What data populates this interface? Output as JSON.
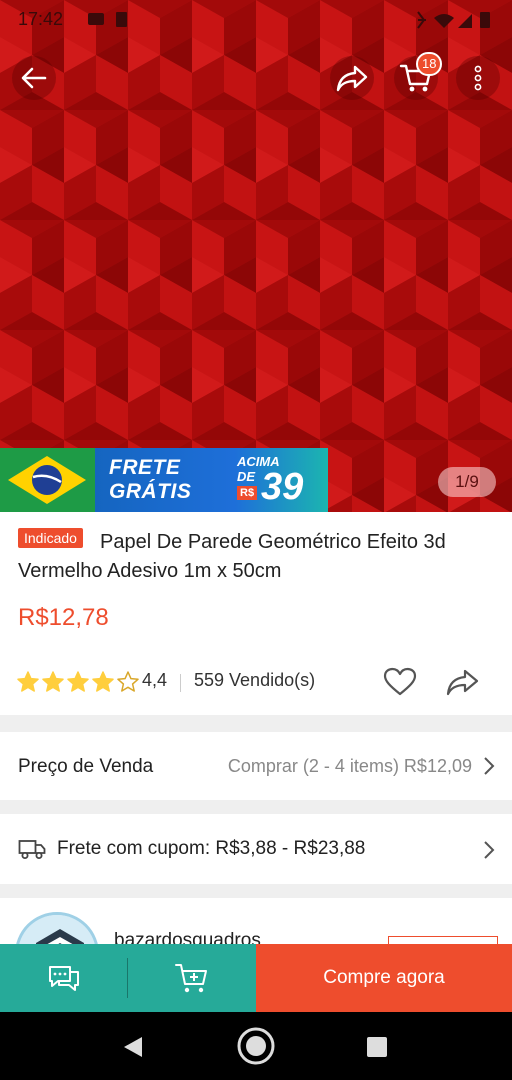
{
  "status_bar": {
    "time": "17:42"
  },
  "header": {
    "cart_count": "18"
  },
  "gallery": {
    "counter": "1/9"
  },
  "promo_banner": {
    "line1": "FRETE",
    "line2": "GRÁTIS",
    "threshold_line1": "ACIMA",
    "threshold_line2": "DE",
    "currency": "R$",
    "amount": "39"
  },
  "product": {
    "badge": "Indicado",
    "title": "Papel De Parede Geométrico Efeito 3d Vermelho Adesivo 1m x 50cm",
    "price": "R$12,78",
    "rating": "4,4",
    "rating_stars": 4.4,
    "sold": "559 Vendido(s)"
  },
  "sale_price_row": {
    "label": "Preço de Venda",
    "value": "Comprar (2 - 4 items) R$12,09"
  },
  "shipping_row": {
    "label": "Frete com cupom: R$3,88 - R$23,88"
  },
  "shop": {
    "name": "bazardosquadros"
  },
  "bottom_bar": {
    "buy_label": "Compre agora"
  },
  "colors": {
    "accent": "#ee4d2d",
    "teal": "#26aa99",
    "hero_red": "#b10a0a",
    "star": "#ffce3d"
  },
  "icons": {
    "back": "arrow-left-icon",
    "share": "share-icon",
    "cart": "cart-icon",
    "more": "more-vertical-icon",
    "heart": "heart-icon",
    "truck": "truck-icon",
    "chat": "chat-icon",
    "add_to_cart": "cart-plus-icon"
  }
}
